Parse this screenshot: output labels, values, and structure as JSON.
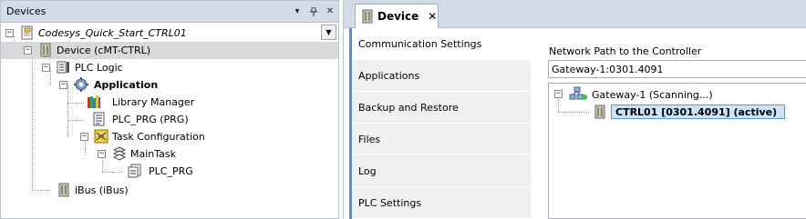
{
  "devices_pane": {
    "title": "Devices",
    "pin_symbol": "⌂",
    "menu_symbol": "▾",
    "close_symbol": "✕"
  },
  "tree": {
    "root": "Codesys_Quick_Start_CTRL01",
    "device": "Device (cMT-CTRL)",
    "plc_logic": "PLC Logic",
    "application": "Application",
    "library_manager": "Library Manager",
    "plc_prg": "PLC_PRG (PRG)",
    "task_configuration": "Task Configuration",
    "main_task": "MainTask",
    "main_task_call": "PLC_PRG",
    "ibus": "iBus (iBus)"
  },
  "editor": {
    "tab_label": "Device",
    "tab_close": "✕",
    "nav": [
      "Communication Settings",
      "Applications",
      "Backup and Restore",
      "Files",
      "Log",
      "PLC Settings"
    ],
    "network_path_label": "Network Path to the Controller",
    "network_path_value": "Gateway-1:0301.4091",
    "gateway_label": "Gateway-1 (Scanning...)",
    "controller_label": "CTRL01 [0301.4091] (active)"
  },
  "colors": {
    "header_bg": "#d2dbe6",
    "selection_bg": "#d9d9d9",
    "accent": "#5b8fcc",
    "controller_selection": "#cde3f7"
  }
}
